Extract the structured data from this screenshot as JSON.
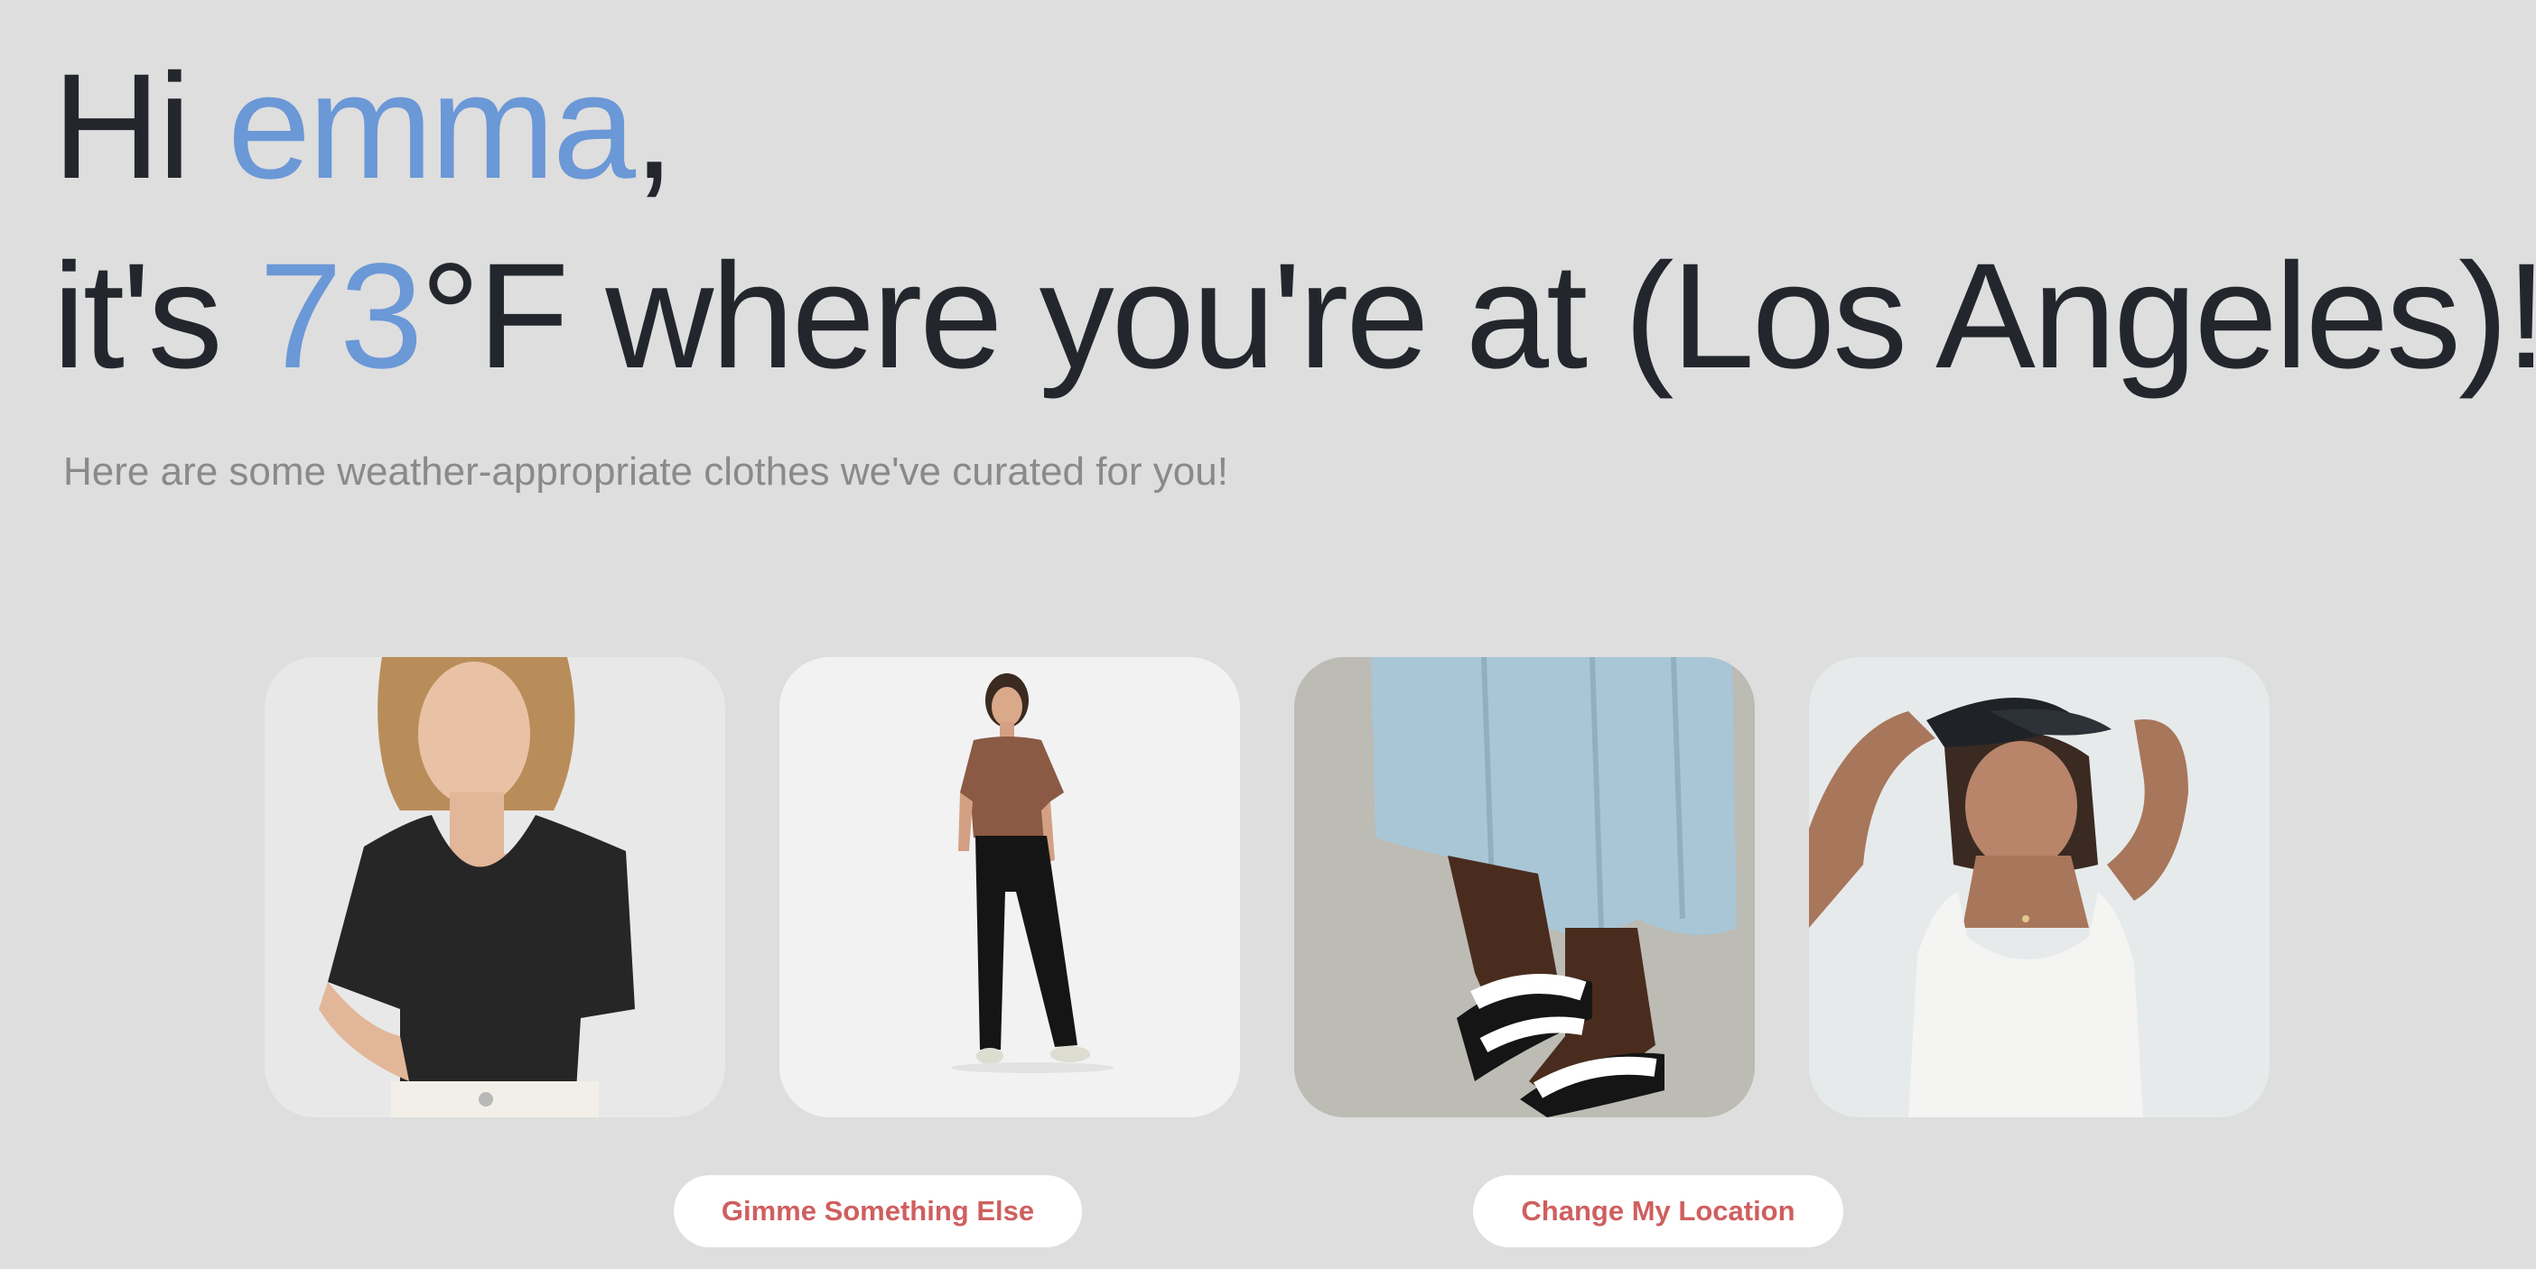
{
  "greeting": {
    "hi": "Hi ",
    "name": "emma",
    "comma": ",",
    "prefix": "it's ",
    "temperature": "73",
    "suffix": "°F where you're at (Los Angeles)!"
  },
  "subtitle": "Here are some weather-appropriate clothes we've curated for you!",
  "outfits": [
    {
      "item": "black scoop-neck top",
      "icon": "outfit-photo"
    },
    {
      "item": "brown tee and black pants",
      "icon": "outfit-photo"
    },
    {
      "item": "blue skirt and white sandals",
      "icon": "outfit-photo"
    },
    {
      "item": "white tank top and black visor",
      "icon": "outfit-photo"
    }
  ],
  "buttons": {
    "gimme_label": "Gimme Something Else",
    "location_label": "Change My Location"
  },
  "colors": {
    "background": "#dedede",
    "accent": "#6b98d6",
    "button_text": "#cf5f5f",
    "heading": "#23272d",
    "subtitle": "#8a8a8a"
  }
}
